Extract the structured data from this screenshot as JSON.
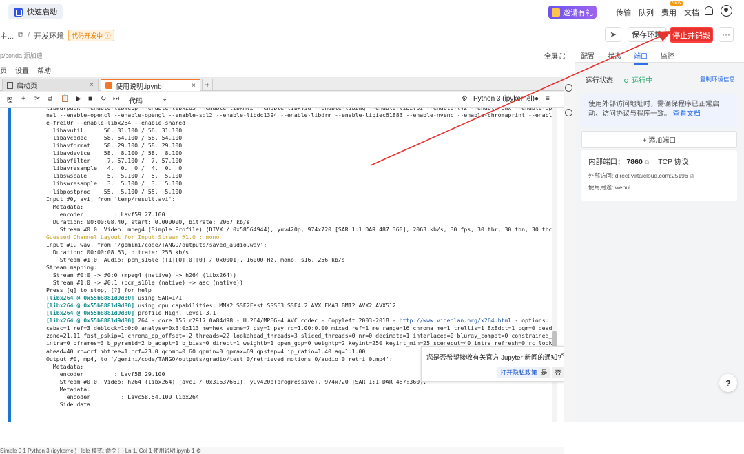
{
  "topbar": {
    "quick_start": "快速启动",
    "invite": "邀请有礼",
    "nav": [
      "传输",
      "队列",
      "费用",
      "文档"
    ],
    "new_badge": "NEW"
  },
  "toolbar": {
    "breadcrumb_prev": "主...",
    "breadcrumb_sep": "/",
    "env_name": "开发环境",
    "dev_tag": "代码开发中 ⓘ",
    "save_env": "保存环境",
    "stop_destroy": "停止并销毁",
    "more": "···"
  },
  "editor": {
    "conda_hint": "p/conda 源加速",
    "fullscreen": "全屏 ⛶",
    "menu": [
      "页",
      "设置",
      "帮助"
    ],
    "tabs": [
      {
        "label": "启动页",
        "close": "×"
      },
      {
        "label": "使用说明.ipynb",
        "close": "×"
      }
    ],
    "add_tab": "+",
    "cell_type": "代码",
    "kernel": "Python 3 (ipykernel)",
    "status_bar": "Simple  0  1  Python 3 (ipykernel) | Idle             模式: 命令   ⓘ   Ln 1, Col 1   使用说明.ipynb   1   ⚙"
  },
  "output_lines": [
    {
      "t": "libwavpack --enable-libwebp --enable-libx265 --enable-libxml2 --enable-libxvid --enable-libzmq --enable-libzvbi --enable-lv2 --enable-omx --enable-ope"
    },
    {
      "t": "nal --enable-opencl --enable-opengl --enable-sdl2 --enable-libdc1394 --enable-libdrm --enable-libiec61883 --enable-nvenc --enable-chromaprint --enabl"
    },
    {
      "t": "e-frei0r --enable-libx264 --enable-shared"
    },
    {
      "t": "  libavutil      56. 31.100 / 56. 31.100"
    },
    {
      "t": "  libavcodec     58. 54.100 / 58. 54.100"
    },
    {
      "t": "  libavformat    58. 29.100 / 58. 29.100"
    },
    {
      "t": "  libavdevice    58.  8.100 / 58.  8.100"
    },
    {
      "t": "  libavfilter     7. 57.100 /  7. 57.100"
    },
    {
      "t": "  libavresample   4.  0.  0 /  4.  0.  0"
    },
    {
      "t": "  libswscale      5.  5.100 /  5.  5.100"
    },
    {
      "t": "  libswresample   3.  5.100 /  3.  5.100"
    },
    {
      "t": "  libpostproc    55.  5.100 / 55.  5.100"
    },
    {
      "t": "Input #0, avi, from 'temp/result.avi':"
    },
    {
      "t": "  Metadata:"
    },
    {
      "t": "    encoder         : Lavf59.27.100"
    },
    {
      "t": "  Duration: 00:00:08.40, start: 0.000000, bitrate: 2067 kb/s"
    },
    {
      "t": "    Stream #0:0: Video: mpeg4 (Simple Profile) (DIVX / 0x58564944), yuv420p, 974x720 [SAR 1:1 DAR 487:360], 2063 kb/s, 30 fps, 30 tbr, 30 tbn, 30 tbc"
    },
    {
      "t": "Guessed Channel Layout for Input Stream #1.0 : mono",
      "cls": "y"
    },
    {
      "t": "Input #1, wav, from '/gemini/code/TANGO/outputs/saved_audio.wav':"
    },
    {
      "t": "  Duration: 00:00:08.53, bitrate: 256 kb/s"
    },
    {
      "t": "    Stream #1:0: Audio: pcm_s16le ([1][0][0][0] / 0x0001), 16000 Hz, mono, s16, 256 kb/s"
    },
    {
      "t": "Stream mapping:"
    },
    {
      "t": "  Stream #0:0 -> #0:0 (mpeg4 (native) -> h264 (libx264))"
    },
    {
      "t": "  Stream #1:0 -> #0:1 (pcm_s16le (native) -> aac (native))"
    },
    {
      "t": "Press [q] to stop, [?] for help"
    },
    {
      "p": "[libx264 @ 0x55b8881d9d80]",
      "t": " using SAR=1/1"
    },
    {
      "p": "[libx264 @ 0x55b8881d9d80]",
      "t": " using cpu capabilities: MMX2 SSE2Fast SSSE3 SSE4.2 AVX FMA3 BMI2 AVX2 AVX512"
    },
    {
      "p": "[libx264 @ 0x55b8881d9d80]",
      "t": " profile High, level 3.1"
    },
    {
      "p": "[libx264 @ 0x55b8881d9d80]",
      "t": " 264 - core 155 r2917 0a84d98 - H.264/MPEG-4 AVC codec - Copyleft 2003-2018 - ",
      "u": "http://www.videolan.org/x264.html",
      "s": " - options:"
    },
    {
      "t": "cabac=1 ref=3 deblock=1:0:0 analyse=0x3:0x113 me=hex subme=7 psy=1 psy_rd=1.00:0.00 mixed_ref=1 me_range=16 chroma_me=1 trellis=1 8x8dct=1 cqm=0 dead"
    },
    {
      "t": "zone=21,11 fast_pskip=1 chroma_qp_offset=-2 threads=22 lookahead_threads=3 sliced_threads=0 nr=0 decimate=1 interlaced=0 bluray_compat=0 constrained_"
    },
    {
      "t": "intra=0 bframes=3 b_pyramid=2 b_adapt=1 b_bias=0 direct=1 weightb=1 open_gop=0 weightp=2 keyint=250 keyint_min=25 scenecut=40 intra_refresh=0 rc_look"
    },
    {
      "t": "ahead=40 rc=crf mbtree=1 crf=23.0 qcomp=0.60 qpmin=0 qpmax=69 qpstep=4 ip_ratio=1.40 aq=1:1.00"
    },
    {
      "t": "Output #0, mp4, to '/gemini/code/TANGO/outputs/gradio/test_0/retrieved_motions_0/audio_0_retri_0.mp4':"
    },
    {
      "t": "  Metadata:"
    },
    {
      "t": "    encoder         : Lavf58.29.100"
    },
    {
      "t": "    Stream #0:0: Video: h264 (libx264) (avc1 / 0x31637661), yuv420p(progressive), 974x720 [SAR 1:1 DAR 487:360],"
    },
    {
      "t": "    Metadata:"
    },
    {
      "t": "      encoder         : Lavc58.54.100 libx264"
    },
    {
      "t": "    Side data:"
    }
  ],
  "notification": {
    "text": "您是否希望接收有关官方 Jupyter 新闻的通知?",
    "close": "×",
    "privacy": "打开隐私政策",
    "yes": "是",
    "no": "否"
  },
  "right_panel": {
    "tabs": [
      "配置",
      "状态",
      "端口",
      "监控"
    ],
    "active_tab": "端口",
    "run_status_label": "运行状态:",
    "run_status_value": "运行中",
    "copy_env_info": "复制环境信息",
    "info_text": "使用外部访问地址时，需确保程序已正常启动、访问协议与程序一致。",
    "info_link": "查看文档",
    "add_port": "+ 添加端口",
    "port": {
      "internal_label": "内部端口：",
      "internal_value": "7860",
      "protocol": "TCP 协议",
      "external_label": "外部访问:",
      "external_value": "direct.virtaicloud.com:25196",
      "usage_label": "使用用途:",
      "usage_value": "webui"
    }
  },
  "help_button": "?",
  "colors": {
    "stop_button": "#e8322e",
    "accent": "#2f6ee6",
    "running": "#2aa86e",
    "jupyter_orange": "#f37726",
    "cell_bar": "#1976d2",
    "annotation_arrow": "#e8322e"
  }
}
